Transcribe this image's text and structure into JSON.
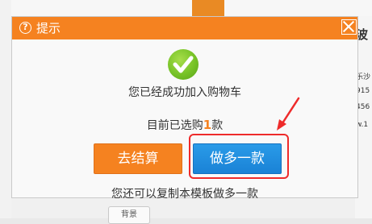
{
  "dialog": {
    "title": "提示",
    "success_message": "您已经成功加入购物车",
    "selected_prefix": "目前已选购",
    "selected_count": "1",
    "selected_suffix": "款",
    "checkout_label": "去结算",
    "buy_more_label": "做多一款",
    "footer_text": "您还可以复制本模板做多一款"
  },
  "background": {
    "right_snippets": [
      "波",
      "乐沙",
      "915",
      "456",
      "w.1"
    ],
    "bottom_button": "背景"
  },
  "colors": {
    "accent_orange": "#f58220",
    "button_blue": "#1a82d6",
    "success_green": "#76c227",
    "annotation_red": "#ee2b2b"
  },
  "icons": [
    "help-icon",
    "close-icon",
    "checkmark-icon",
    "annotation-arrow"
  ]
}
